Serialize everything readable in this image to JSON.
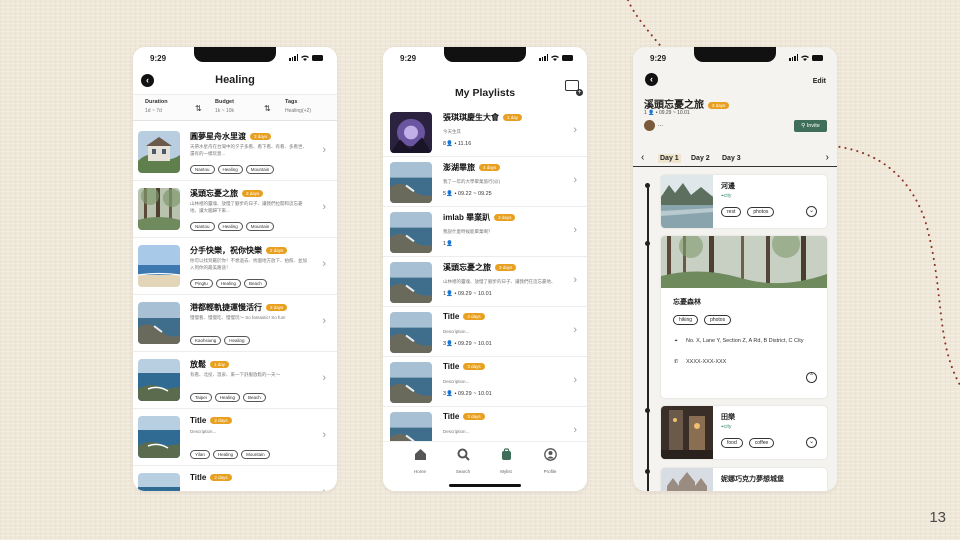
{
  "page_number": "13",
  "colors": {
    "accent_badge": "#e8a020",
    "invite_green": "#3f6f5a",
    "city_teal": "#4a8f7a",
    "background": "#efe7d8"
  },
  "status": {
    "time": "9:29"
  },
  "screen1": {
    "title": "Healing",
    "filters": [
      {
        "label": "Duration",
        "value": "1d ~ 7d"
      },
      {
        "label": "Budget",
        "value": "1k ~ 10k"
      },
      {
        "label": "Tags",
        "value": "Healing(+2)"
      }
    ],
    "items": [
      {
        "title": "圓夢星舟水里渡",
        "badge": "3 days",
        "desc": "天帶水星舟在台灣中的夕子多看、看下看、有看、多看世、還有的一樣玩意...",
        "tags": [
          "Nantou",
          "Healing",
          "Mountain"
        ],
        "icon": "house-photo"
      },
      {
        "title": "溪頭忘憂之旅",
        "badge": "3 days",
        "desc": "山林裡的靈魂、放慢了腳步的日子、讓我們拉開和這忘憂地、讓大腦歸下來...",
        "tags": [
          "Nantou",
          "Healing",
          "Mountain"
        ],
        "icon": "forest-photo"
      },
      {
        "title": "分手快樂，祝你快樂",
        "badge": "2 days",
        "desc": "你可以找到屬於你！不想過去、找個地方放下、拍照、並加入到你的最美路途！",
        "tags": [
          "Pingtu",
          "Healing",
          "Beach"
        ],
        "icon": "beach-photo"
      },
      {
        "title": "港都輕軌捷運慢活行",
        "badge": "3 days",
        "desc": "慢慢看、慢慢吃、慢慢玩～ So fantastic! So fun!",
        "tags": [
          "Kaohsiung",
          "Healing"
        ],
        "icon": "coast-photo"
      },
      {
        "title": "放鬆",
        "badge": "1 day",
        "desc": "有看、北投、溫泉、來一下舒服放鬆的一天～",
        "tags": [
          "Taipei",
          "Healing",
          "Beach"
        ],
        "icon": "sea-photo"
      },
      {
        "title": "Title",
        "badge": "2 days",
        "desc": "Description...",
        "tags": [
          "Yilan",
          "Healing",
          "Mountain"
        ],
        "icon": "sea-photo"
      },
      {
        "title": "Title",
        "badge": "2 days",
        "desc": "",
        "tags": [],
        "icon": "sea-photo"
      }
    ]
  },
  "screen2": {
    "title": "My Playlists",
    "items": [
      {
        "title": "張琪琪慶生大會",
        "badge": "1 day",
        "desc": "今天生其",
        "members": "8",
        "date": "11.16",
        "icon": "cave-photo"
      },
      {
        "title": "澎湖畢旅",
        "badge": "4 days",
        "desc": "我了一年的大學畢業旅行(@)",
        "members": "5",
        "date": "09.22 ~ 09.25",
        "icon": "coast-photo"
      },
      {
        "title": "imlab 畢業趴",
        "badge": "3 days",
        "desc": "我說什麼時候能畢業啊？",
        "members": "1",
        "date": "",
        "icon": "coast-photo"
      },
      {
        "title": "溪頭忘憂之旅",
        "badge": "3 days",
        "desc": "山林裡的靈魂、放慢了腳步的日子、讓我們在這忘憂地、讓大腦歸下來...",
        "members": "1",
        "date": "09.29 ~ 10.01",
        "icon": "coast-photo"
      },
      {
        "title": "Title",
        "badge": "3 days",
        "desc": "Description...",
        "members": "3",
        "date": "09.29 ~ 10.01",
        "icon": "coast-photo"
      },
      {
        "title": "Title",
        "badge": "3 days",
        "desc": "Description...",
        "members": "3",
        "date": "09.29 ~ 10.01",
        "icon": "coast-photo"
      },
      {
        "title": "Title",
        "badge": "3 days",
        "desc": "Description...",
        "members": "",
        "date": "",
        "icon": "coast-photo"
      }
    ],
    "tabs": [
      "Home",
      "Search",
      "Mylist",
      "Profile"
    ]
  },
  "screen3": {
    "edit": "Edit",
    "title": "溪頭忘憂之旅",
    "badge": "3 days",
    "members": "1",
    "date": "09.29 ~ 10.01",
    "more": "...",
    "invite": "Invite",
    "days": [
      "Day 1",
      "Day 2",
      "Day 3"
    ],
    "cards": [
      {
        "name": "河邊",
        "city": "city",
        "tags": [
          "rest",
          "photos"
        ]
      },
      {
        "name": "忘憂森林",
        "tags": [
          "hiking",
          "photos"
        ],
        "address": "No. X, Lane Y, Section Z, A Rd, B District, C City",
        "phone": "XXXX-XXX-XXX"
      },
      {
        "name": "田樂",
        "city": "city",
        "tags": [
          "food",
          "coffee"
        ]
      },
      {
        "name": "妮娜巧克力夢想城堡"
      }
    ]
  }
}
